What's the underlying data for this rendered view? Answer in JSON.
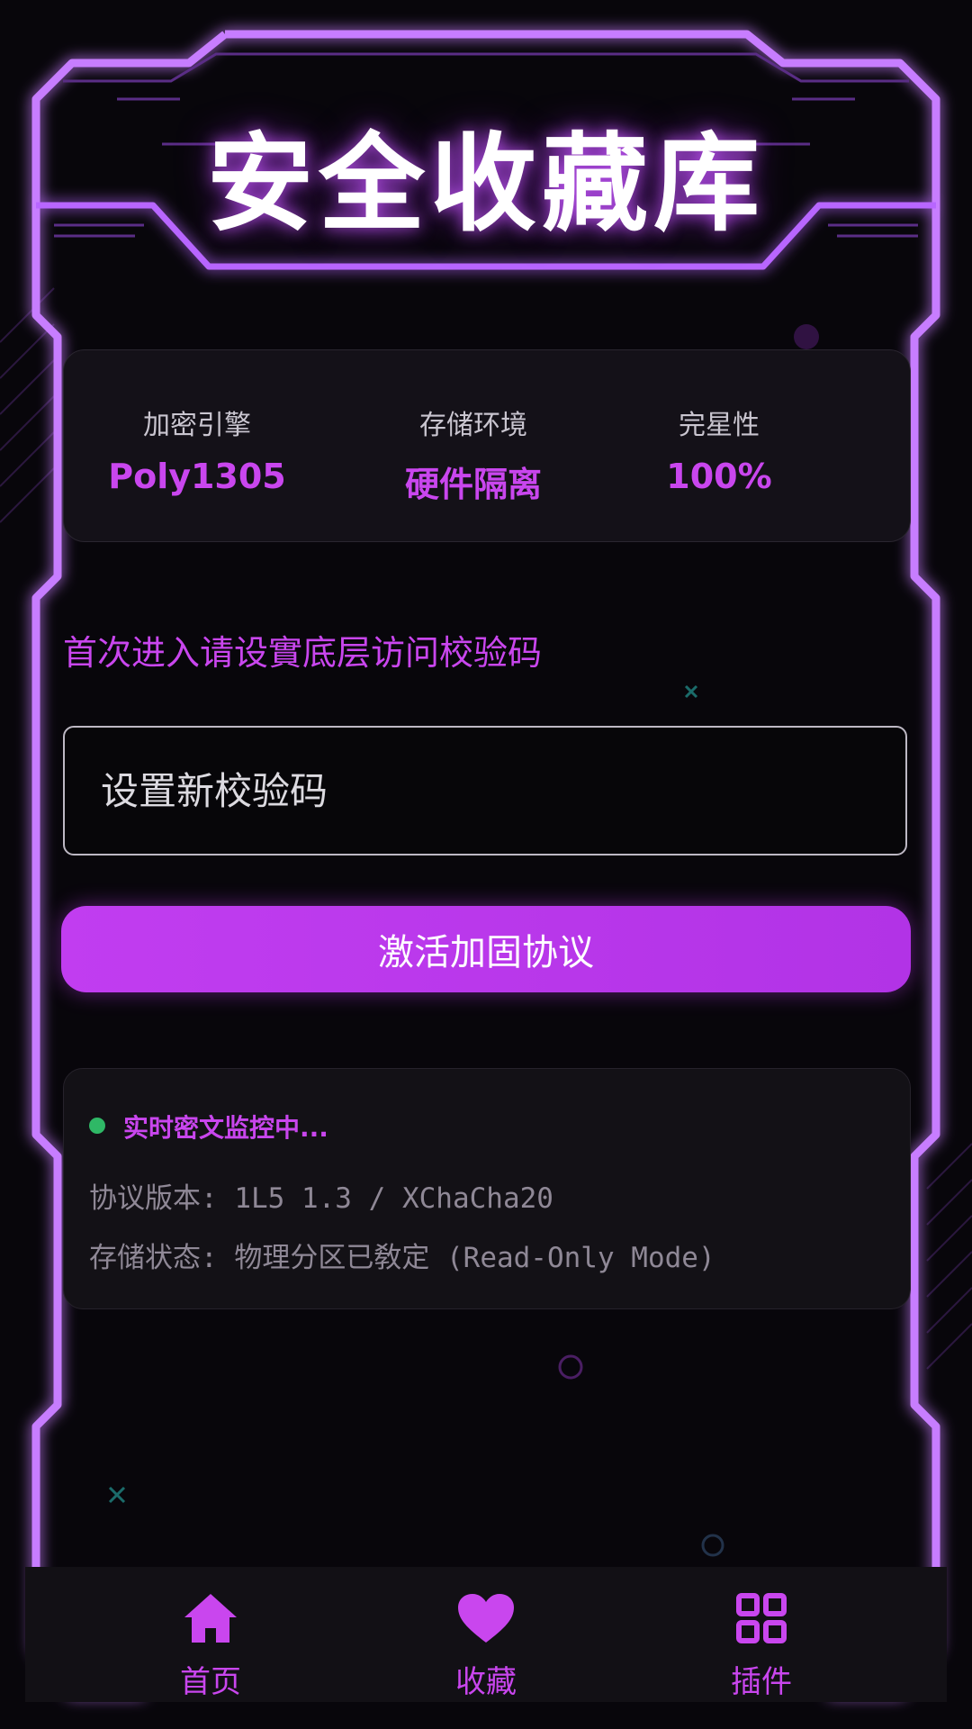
{
  "app": {
    "title": "安全收藏库"
  },
  "stats": [
    {
      "label": "加密引擎",
      "value": "Poly1305"
    },
    {
      "label": "存储环境",
      "value": "硬件隔离"
    },
    {
      "label": "完星性",
      "value": "100%"
    }
  ],
  "setup": {
    "prompt": "首次进入请设實底层访问校验码",
    "input_placeholder": "设置新校验码",
    "input_value": "",
    "activate_label": "激活加固协议"
  },
  "monitor": {
    "status": "实时密文监控中...",
    "status_color": "#2fb866",
    "lines": [
      "协议版本: 1L5 1.3 / XChaCha20",
      "存储状态: 物理分区已敎定 (Read-Only Mode)"
    ]
  },
  "nav": {
    "items": [
      {
        "label": "首页",
        "icon": "home-icon"
      },
      {
        "label": "收藏",
        "icon": "heart-icon"
      },
      {
        "label": "插件",
        "icon": "grid-icon"
      }
    ]
  },
  "colors": {
    "accent": "#c946ee",
    "neon_frame": "#a855f7",
    "background": "#08060b"
  }
}
